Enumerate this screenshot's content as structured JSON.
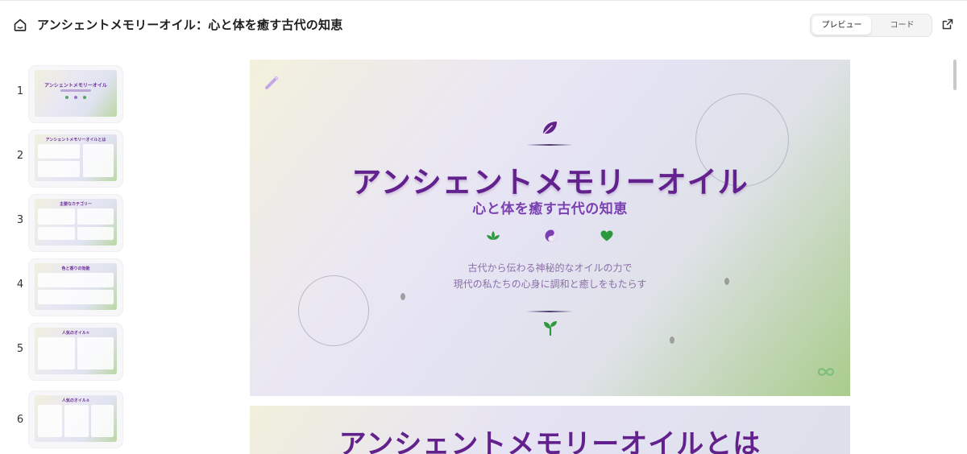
{
  "header": {
    "title": "アンシェントメモリーオイル：心と体を癒す古代の知恵",
    "toggle": {
      "preview_label": "プレビュー",
      "code_label": "コード",
      "active": "preview"
    },
    "icons": {
      "home": "home-icon",
      "external": "external-link-icon"
    }
  },
  "sidebar": {
    "slides": [
      {
        "number": "1",
        "thumb_title": "アンシェントメモリーオイル"
      },
      {
        "number": "2",
        "thumb_title": "アンシェントメモリーオイルとは"
      },
      {
        "number": "3",
        "thumb_title": "主要なカテゴリー"
      },
      {
        "number": "4",
        "thumb_title": "色と香りの効能"
      },
      {
        "number": "5",
        "thumb_title": "人気のオイル①"
      },
      {
        "number": "6",
        "thumb_title": "人気のオイル②"
      }
    ]
  },
  "slide": {
    "title": "アンシェントメモリーオイル",
    "subtitle": "心と体を癒す古代の知恵",
    "description_line1": "古代から伝わる神秘的なオイルの力で",
    "description_line2": "現代の私たちの心身に調和と癒しをもたらす",
    "icons": [
      "leaf-icon",
      "lotus-icon",
      "yin-yang-icon",
      "heart-icon",
      "sprout-icon",
      "wand-icon",
      "infinity-icon"
    ],
    "colors": {
      "title": "#62218d",
      "subtitle": "#7a3fb0",
      "green": "#2c9a3c"
    }
  },
  "next_slide": {
    "title": "アンシェントメモリーオイルとは"
  }
}
